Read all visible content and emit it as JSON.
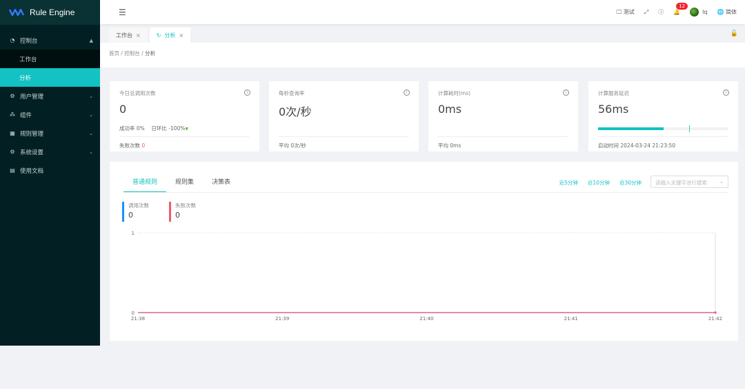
{
  "app": {
    "title": "Rule Engine"
  },
  "sidebar": {
    "items": [
      {
        "label": "控制台",
        "icon": "dashboard-icon",
        "expanded": true
      },
      {
        "label": "工作台",
        "sub": true
      },
      {
        "label": "分析",
        "sub": true,
        "active": true
      },
      {
        "label": "用户管理",
        "icon": "gear-icon"
      },
      {
        "label": "组件",
        "icon": "cluster-icon"
      },
      {
        "label": "规则管理",
        "icon": "grid-icon"
      },
      {
        "label": "系统设置",
        "icon": "gear-icon"
      },
      {
        "label": "使用文档",
        "icon": "document-icon"
      }
    ]
  },
  "header": {
    "env": "测试",
    "notifications": "12",
    "user": "lq",
    "lang": "简体"
  },
  "tabs": [
    {
      "label": "工作台"
    },
    {
      "label": "分析",
      "active": true
    }
  ],
  "breadcrumb": [
    "首页",
    "控制台",
    "分析"
  ],
  "cards": [
    {
      "title": "今日总调用次数",
      "value": "0",
      "success_label": "成功率",
      "success": "0%",
      "dod_label": "日环比",
      "dod": "-100%",
      "foot_label": "失败次数",
      "foot_value": "0"
    },
    {
      "title": "每秒查询率",
      "value": "0次/秒",
      "foot_label": "平均",
      "foot_value": "0次/秒"
    },
    {
      "title": "计算耗时(ms)",
      "value": "0ms",
      "foot_label": "平均",
      "foot_value": "0ms"
    },
    {
      "title": "计算服务延迟",
      "value": "56ms",
      "progress": 0.5,
      "target": 0.7,
      "foot_label": "启动时间",
      "foot_value": "2024-03-24 21:23:50"
    }
  ],
  "panel": {
    "tabs": [
      "普通规则",
      "规则集",
      "决策表"
    ],
    "ranges": [
      "近5分钟",
      "近10分钟",
      "近30分钟"
    ],
    "search_placeholder": "请输入关键字进行搜索",
    "stats": [
      {
        "label": "调用次数",
        "value": "0",
        "color": "#1890ff"
      },
      {
        "label": "失败次数",
        "value": "0",
        "color": "#f5576c"
      }
    ]
  },
  "chart_data": {
    "type": "line",
    "x": [
      "21:38",
      "21:39",
      "21:40",
      "21:41",
      "21:42"
    ],
    "series": [
      {
        "name": "调用次数",
        "values": [
          0,
          0,
          0,
          0,
          0
        ],
        "color": "#1890ff"
      },
      {
        "name": "失败次数",
        "values": [
          0,
          0,
          0,
          0,
          0
        ],
        "color": "#f5576c"
      }
    ],
    "yticks": [
      "0",
      "1"
    ],
    "ylim": [
      0,
      1
    ]
  }
}
